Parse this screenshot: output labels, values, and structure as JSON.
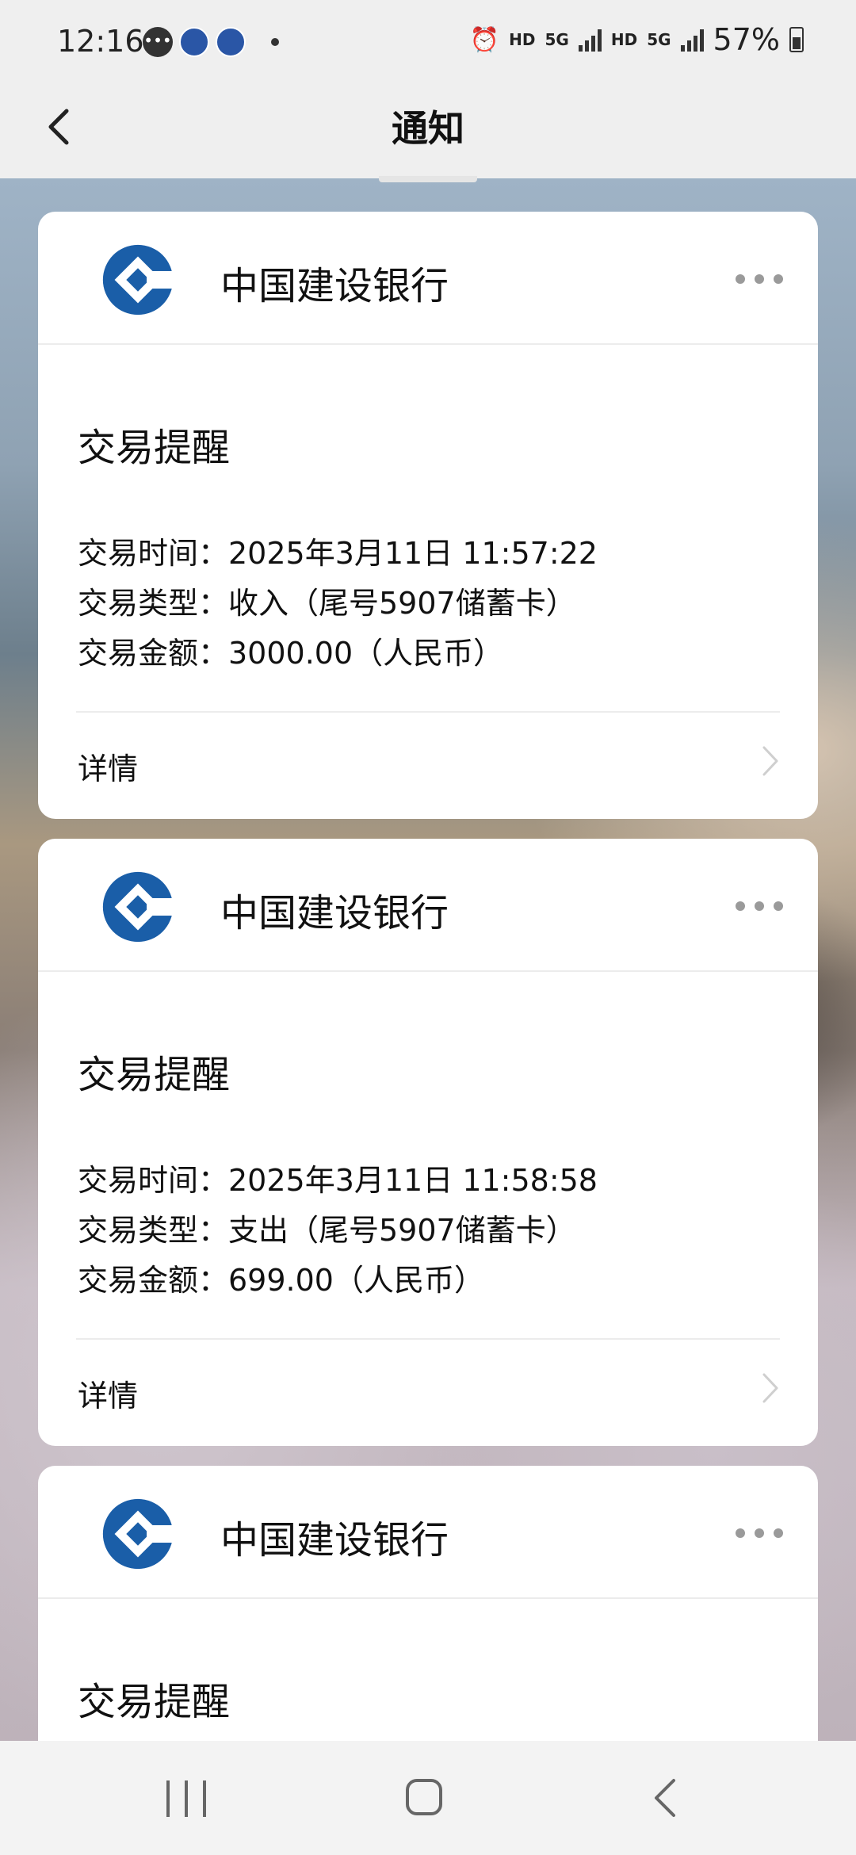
{
  "status_bar": {
    "time": "12:16",
    "msg_icon": "chat-bubble-icon",
    "hd1": "HD",
    "net1": "5G",
    "hd2": "HD",
    "net2": "5G",
    "battery": "57%"
  },
  "header": {
    "title": "通知"
  },
  "cards": [
    {
      "bank": "中国建设银行",
      "title": "交易提醒",
      "fields": [
        "交易时间：2025年3月11日 11:57:22",
        "交易类型：收入（尾号5907储蓄卡）",
        "交易金额：3000.00（人民币）"
      ],
      "detail": "详情"
    },
    {
      "bank": "中国建设银行",
      "title": "交易提醒",
      "fields": [
        "交易时间：2025年3月11日 11:58:58",
        "交易类型：支出（尾号5907储蓄卡）",
        "交易金额：699.00（人民币）"
      ],
      "detail": "详情"
    },
    {
      "bank": "中国建设银行",
      "title": "交易提醒"
    }
  ],
  "colors": {
    "bank_blue": "#1a5ea8",
    "header_bg": "#efefef"
  }
}
